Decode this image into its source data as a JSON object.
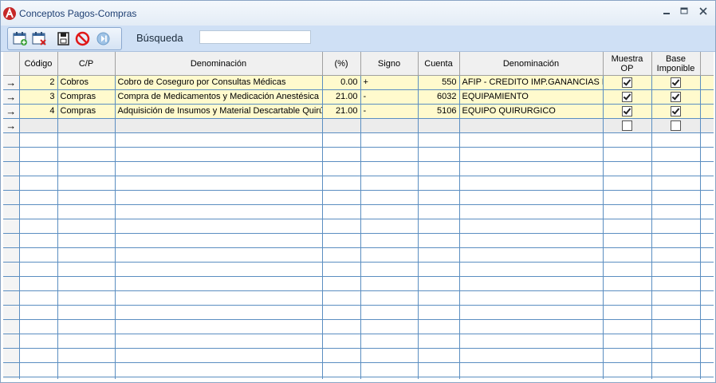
{
  "window": {
    "title": "Conceptos Pagos-Compras"
  },
  "search": {
    "label": "Búsqueda",
    "value": "",
    "placeholder": ""
  },
  "toolbar": {
    "icons": [
      "calendar-add-icon",
      "calendar-delete-icon",
      "save-icon",
      "cancel-icon",
      "exit-icon"
    ]
  },
  "colors": {
    "row_highlight": "#fffacd",
    "grid_line": "#5b8ec1",
    "toolbar_bg": "#cfe0f5",
    "title_text": "#1e3f73"
  },
  "grid": {
    "columns": [
      "Código",
      "C/P",
      "Denominación",
      "(%)",
      "Signo",
      "Cuenta",
      "Denominación",
      "Muestra OP",
      "Base Imponible"
    ],
    "rows": [
      {
        "indicator": "→",
        "codigo": "2",
        "cp": "Cobros",
        "denominacion": "Cobro de Coseguro por Consultas Médicas",
        "pct": "0.00",
        "signo": "+",
        "cuenta": "550",
        "denominacion_cuenta": "AFIP - CREDITO IMP.GANANCIAS DE",
        "muestra_op": true,
        "base_imponible": true
      },
      {
        "indicator": "→",
        "codigo": "3",
        "cp": "Compras",
        "denominacion": "Compra de Medicamentos y Medicación Anestésica",
        "pct": "21.00",
        "signo": "-",
        "cuenta": "6032",
        "denominacion_cuenta": "EQUIPAMIENTO",
        "muestra_op": true,
        "base_imponible": true
      },
      {
        "indicator": "→",
        "codigo": "4",
        "cp": "Compras",
        "denominacion": "Adquisición de Insumos y Material Descartable Quirúrgico",
        "pct": "21.00",
        "signo": "-",
        "cuenta": "5106",
        "denominacion_cuenta": "EQUIPO  QUIRURGICO",
        "muestra_op": true,
        "base_imponible": true
      },
      {
        "indicator": "→",
        "codigo": "",
        "cp": "",
        "denominacion": "",
        "pct": "",
        "signo": "",
        "cuenta": "",
        "denominacion_cuenta": "",
        "muestra_op": false,
        "base_imponible": false
      }
    ]
  }
}
